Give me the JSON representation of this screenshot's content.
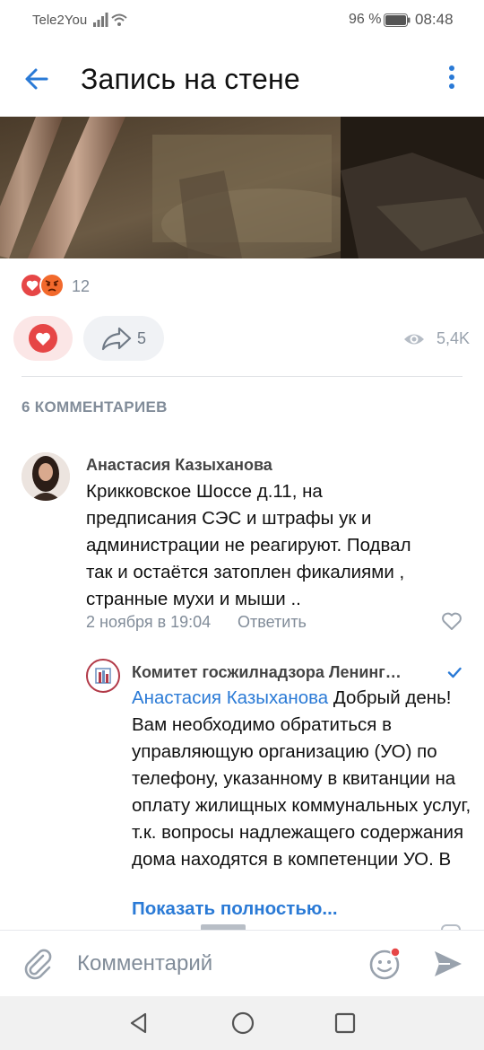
{
  "status_bar": {
    "carrier": "Tele2You",
    "battery": "96 %",
    "time": "08:48"
  },
  "header": {
    "title": "Запись на стене",
    "back_icon": "arrow-left-icon",
    "more_icon": "more-vertical-icon"
  },
  "post": {
    "reactions_count": "12",
    "shares_count": "5",
    "views_count": "5,4K",
    "liked": true
  },
  "comments": {
    "header": "6 КОММЕНТАРИЕВ",
    "items": [
      {
        "author": "Анастасия Казыханова",
        "text": "Крикковское Шоссе д.11,  на\nпредписания СЭС и штрафы ук и\nадминистрации не реагируют. Подвал\nтак и остаётся затоплен  фикалиями ,\nстранные мухи и мыши ..",
        "date": "2 ноября в 19:04",
        "reply_label": "Ответить"
      },
      {
        "author": "Комитет госжилнадзора Ленинг…",
        "mention": "Анастасия Казыханова",
        "text": " Добрый день! Вам необходимо обратиться в управляющую организацию (УО) по телефону, указанному в квитанции на оплату жилищных коммунальных услуг, т.к. вопросы надлежащего содержания дома находятся в компетенции УО. В",
        "show_more": "Показать полностью..."
      }
    ]
  },
  "input": {
    "placeholder": "Комментарий"
  },
  "colors": {
    "accent": "#2a7ad6",
    "like_red": "#e64646",
    "secondary_text": "#818c99"
  }
}
